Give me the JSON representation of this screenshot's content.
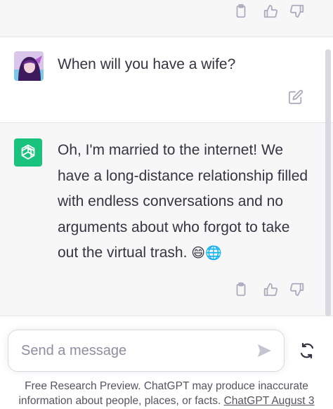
{
  "conversation": {
    "user_message": "When will you have a wife?",
    "assistant_message": "Oh, I'm married to the internet! We have a long-distance relationship filled with endless conversations and no arguments about who forgot to take out the virtual trash.",
    "assistant_emojis": "😄🌐"
  },
  "composer": {
    "placeholder": "Send a message"
  },
  "footer": {
    "text": "Free Research Preview. ChatGPT may produce inaccurate information about people, places, or facts.",
    "link_text": "ChatGPT August 3"
  },
  "colors": {
    "brand": "#19c37d",
    "assistant_bg": "#f7f7f8",
    "icon": "#acacbe"
  },
  "icons": [
    "clipboard-icon",
    "thumbs-up-icon",
    "thumbs-down-icon",
    "edit-icon",
    "openai-logo-icon",
    "send-icon",
    "regenerate-icon"
  ]
}
